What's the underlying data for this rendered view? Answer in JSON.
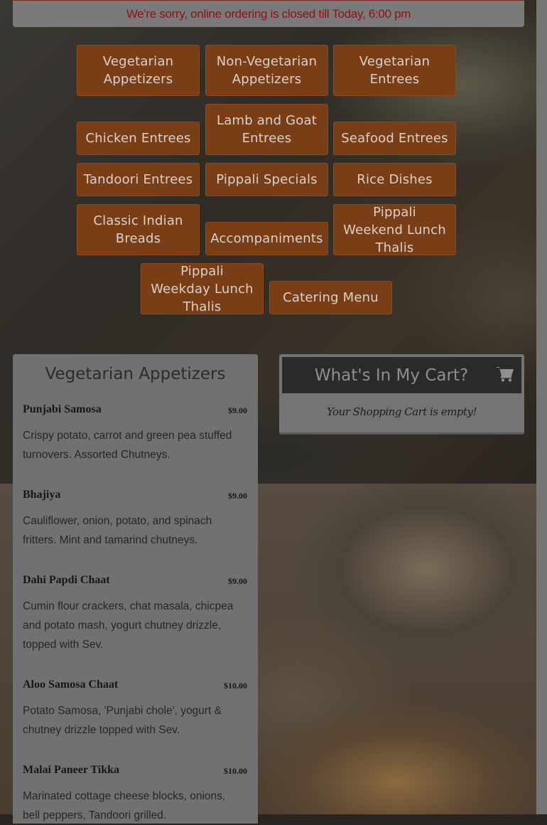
{
  "banner": {
    "text": "We're sorry, online ordering is closed till Today, 6:00 pm"
  },
  "categories": [
    "Vegetarian Appetizers",
    "Non-Vegetarian Appetizers",
    "Vegetarian Entrees",
    "Chicken Entrees",
    "Lamb and Goat Entrees",
    "Seafood Entrees",
    "Tandoori Entrees",
    "Pippali Specials",
    "Rice Dishes",
    "Classic Indian Breads",
    "Accompaniments",
    "Pippali Weekend Lunch Thalis",
    "Pippali Weekday Lunch Thalis",
    "Catering Menu"
  ],
  "menu": {
    "title": "Vegetarian Appetizers",
    "items": [
      {
        "name": "Punjabi Samosa",
        "price": "$9.00",
        "desc": "Crispy potato, carrot and green pea stuffed turnovers. Assorted Chutneys."
      },
      {
        "name": "Bhajiya",
        "price": "$9.00",
        "desc": "Cauliflower, onion, potato, and spinach fritters. Mint and tamarind chutneys."
      },
      {
        "name": "Dahi Papdi Chaat",
        "price": "$9.00",
        "desc": "Cumin flour crackers, chat masala, chicpea and potato mash, yogurt chutney drizzle, topped with Sev."
      },
      {
        "name": "Aloo Samosa Chaat",
        "price": "$10.00",
        "desc": "Potato Samosa, 'Punjabi chole', yogurt & chutney drizzle topped with Sev."
      },
      {
        "name": "Malai Paneer Tikka",
        "price": "$10.00",
        "desc": "Marinated cottage cheese blocks, onions, bell peppers, Tandoori grilled."
      }
    ]
  },
  "cart": {
    "title": "What's In My Cart?",
    "icon": "shopping-cart-icon",
    "empty_text": "Your Shopping Cart is empty!"
  },
  "colors": {
    "button_bg": "#7a3e17",
    "banner_text": "#8a1414",
    "panel_bg": "#717171"
  }
}
